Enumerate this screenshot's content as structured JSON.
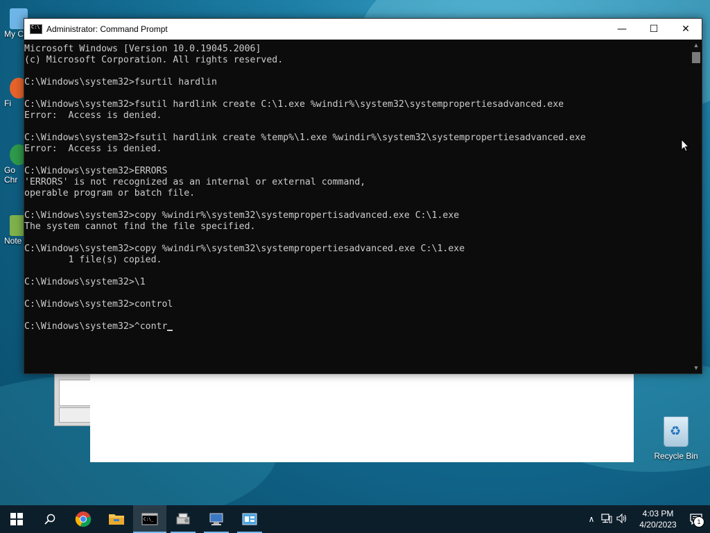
{
  "desktop": {
    "left_icons": [
      {
        "label": "My Co",
        "name": "desktop-icon-my-computer",
        "color": "#6fb6e8"
      },
      {
        "label": "Fi",
        "name": "desktop-icon-firefox",
        "color": "#e8632b"
      },
      {
        "label": "Go",
        "label2": "Chr",
        "name": "desktop-icon-google-chrome",
        "color": "#2e9a4a"
      },
      {
        "label": "Note",
        "name": "desktop-icon-notepad",
        "color": "#7fb24a"
      }
    ],
    "recycle_bin": {
      "label": "Recycle Bin"
    }
  },
  "cmd": {
    "title": "Administrator: Command Prompt",
    "controls": {
      "minimize": "—",
      "maximize": "☐",
      "close": "✕"
    },
    "lines": [
      "Microsoft Windows [Version 10.0.19045.2006]",
      "(c) Microsoft Corporation. All rights reserved.",
      "",
      "C:\\Windows\\system32>fsurtil hardlin",
      "",
      "C:\\Windows\\system32>fsutil hardlink create C:\\1.exe %windir%\\system32\\systempropertiesadvanced.exe",
      "Error:  Access is denied.",
      "",
      "C:\\Windows\\system32>fsutil hardlink create %temp%\\1.exe %windir%\\system32\\systempropertiesadvanced.exe",
      "Error:  Access is denied.",
      "",
      "C:\\Windows\\system32>ERRORS",
      "'ERRORS' is not recognized as an internal or external command,",
      "operable program or batch file.",
      "",
      "C:\\Windows\\system32>copy %windir%\\system32\\systempropertisadvanced.exe C:\\1.exe",
      "The system cannot find the file specified.",
      "",
      "C:\\Windows\\system32>copy %windir%\\system32\\systempropertiesadvanced.exe C:\\1.exe",
      "        1 file(s) copied.",
      "",
      "C:\\Windows\\system32>\\1",
      "",
      "C:\\Windows\\system32>control",
      ""
    ],
    "current_prompt": "C:\\Windows\\system32>^contr"
  },
  "taskbar": {
    "apps": [
      {
        "name": "taskbar-start-button",
        "type": "start"
      },
      {
        "name": "taskbar-search-button",
        "glyph": "⚲"
      },
      {
        "name": "taskbar-chrome-button",
        "type": "chrome"
      },
      {
        "name": "taskbar-file-explorer-button",
        "type": "folder"
      },
      {
        "name": "taskbar-command-prompt-button",
        "type": "cmd",
        "active": true
      },
      {
        "name": "taskbar-app-1-button",
        "type": "app1",
        "running": true
      },
      {
        "name": "taskbar-app-2-button",
        "type": "app2",
        "running": true
      },
      {
        "name": "taskbar-app-3-button",
        "type": "app3",
        "running": true
      }
    ],
    "tray": {
      "chevron": "∧",
      "network": "🖧",
      "volume": "🔊",
      "time": "4:03 PM",
      "date": "4/20/2023",
      "notification_count": "1"
    }
  }
}
